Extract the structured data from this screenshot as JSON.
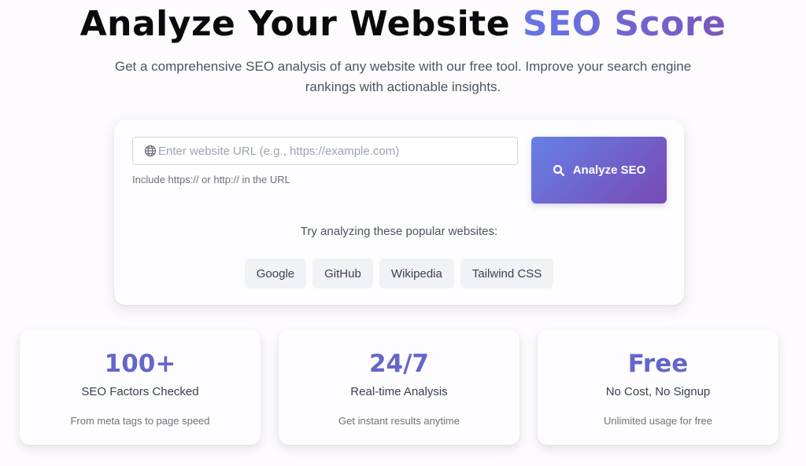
{
  "hero": {
    "title_main": "Analyze Your Website ",
    "title_accent": "SEO Score",
    "subtitle": "Get a comprehensive SEO analysis of any website with our free tool. Improve your search engine rankings with actionable insights."
  },
  "search": {
    "icon": "globe-icon",
    "placeholder": "Enter website URL (e.g., https://example.com)",
    "value": "",
    "hint": "Include https:// or http:// in the URL",
    "button_icon": "search-icon",
    "button_label": "Analyze SEO"
  },
  "popular": {
    "label": "Try analyzing these popular websites:",
    "sites": [
      "Google",
      "GitHub",
      "Wikipedia",
      "Tailwind CSS"
    ]
  },
  "stats": [
    {
      "value": "100+",
      "label": "SEO Factors Checked",
      "desc": "From meta tags to page speed"
    },
    {
      "value": "24/7",
      "label": "Real-time Analysis",
      "desc": "Get instant results anytime"
    },
    {
      "value": "Free",
      "label": "No Cost, No Signup",
      "desc": "Unlimited usage for free"
    }
  ],
  "colors": {
    "accent_start": "#6577e6",
    "accent_end": "#7a56be",
    "stat_value": "#6566c8",
    "chip_bg": "#f1f2f5"
  }
}
